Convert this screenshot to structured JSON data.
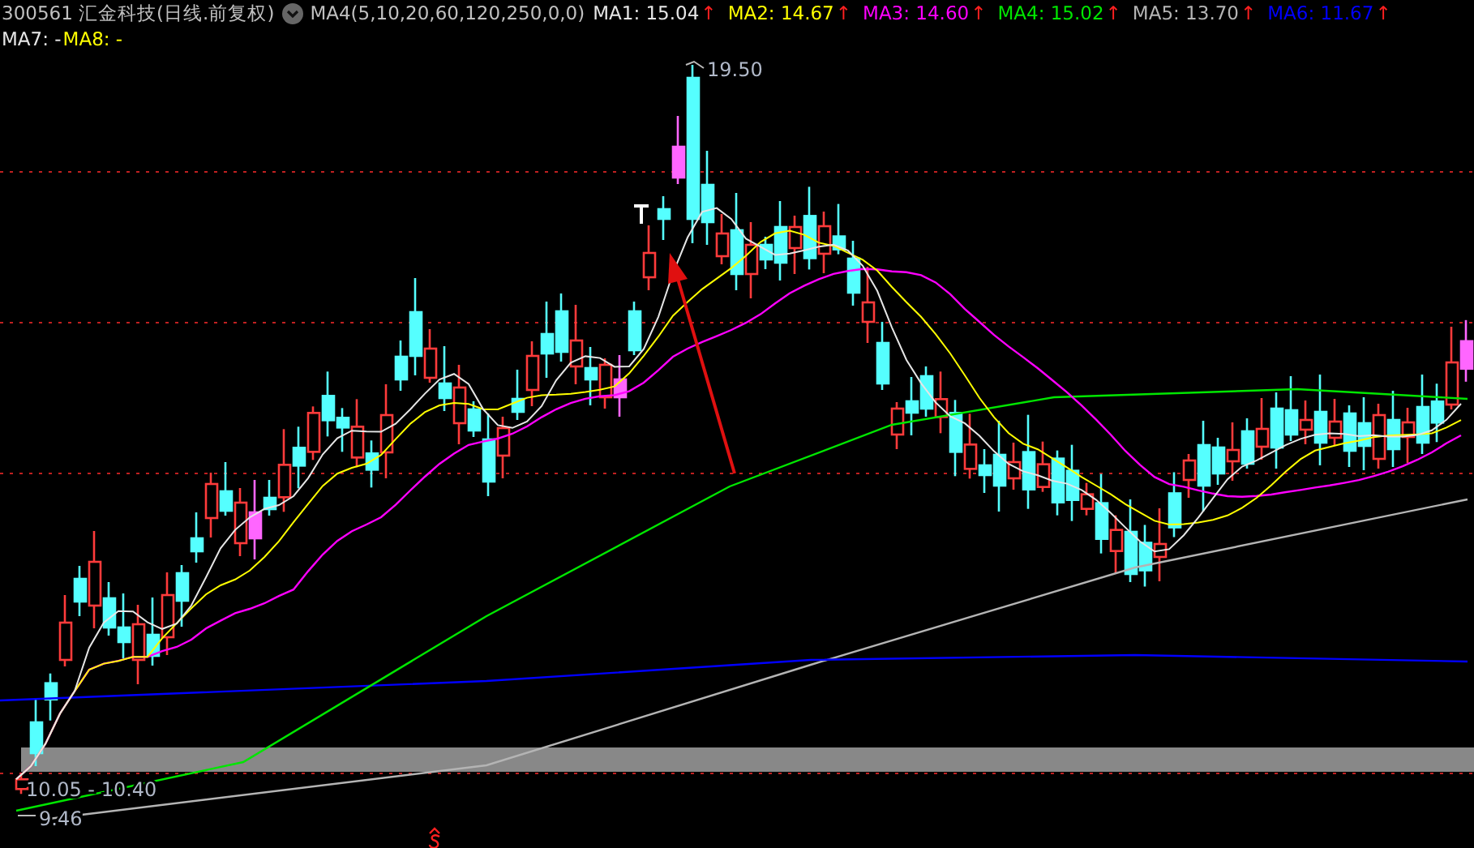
{
  "header": {
    "title": "300561 汇金科技(日线.前复权)",
    "indicator": "MA4(5,10,20,60,120,250,0,0)"
  },
  "ma_rows": [
    [
      {
        "label": "MA1: 15.04",
        "color": "#e6e6e6",
        "arrow": "↑"
      },
      {
        "label": "MA2: 14.67",
        "color": "#ffff00",
        "arrow": "↑"
      },
      {
        "label": "MA3: 14.60",
        "color": "#ff00ff",
        "arrow": "↑"
      },
      {
        "label": "MA4: 15.02",
        "color": "#00e600",
        "arrow": "↑"
      },
      {
        "label": "MA5: 13.70",
        "color": "#b4b4b4",
        "arrow": "↑"
      },
      {
        "label": "MA6: 11.67",
        "color": "#0000ff",
        "arrow": "↑"
      }
    ],
    [
      {
        "label": "MA7: -",
        "color": "#e6e6e6"
      },
      {
        "label": "MA8: -",
        "color": "#ffff00"
      }
    ]
  ],
  "chart": {
    "high_label": "19.50",
    "range_label": "10.05 - 10.40",
    "low_label": "9.46"
  }
}
